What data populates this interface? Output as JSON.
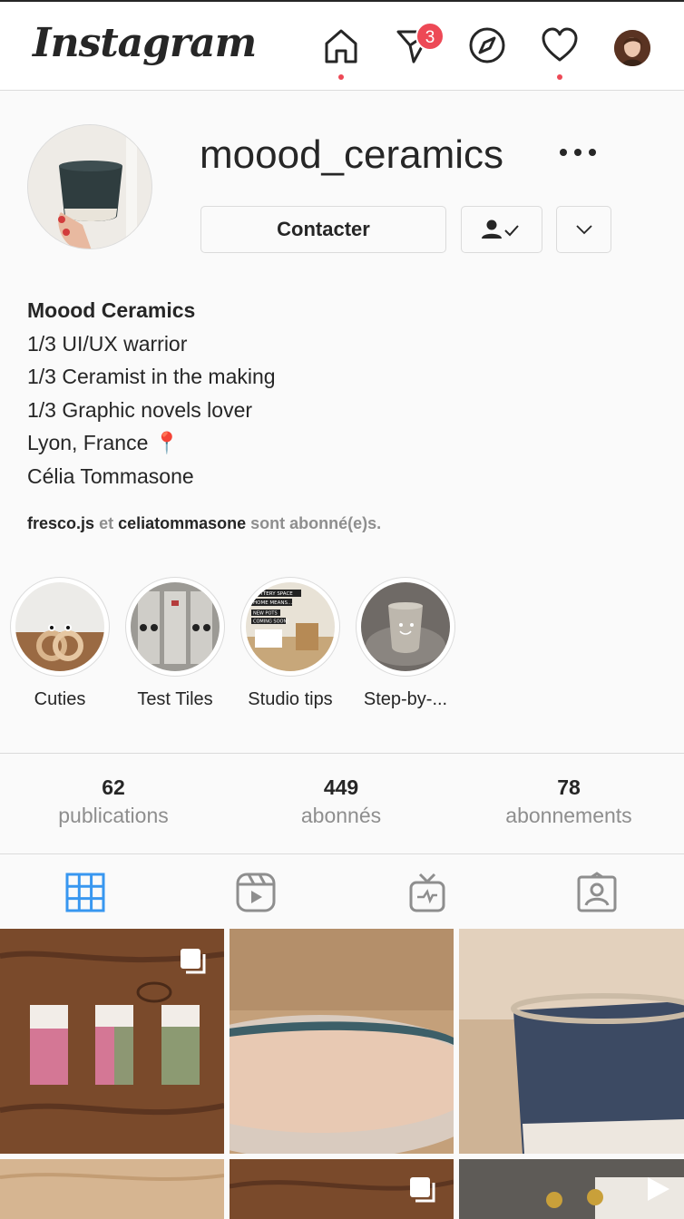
{
  "header": {
    "logo": "Instagram",
    "nav": [
      {
        "icon": "home-icon"
      },
      {
        "icon": "direct-message-icon",
        "badge": "3"
      },
      {
        "icon": "explore-compass-icon"
      },
      {
        "icon": "activity-heart-icon"
      },
      {
        "icon": "profile-avatar"
      }
    ],
    "badge_color": "#ed4956"
  },
  "profile": {
    "username": "moood_ceramics",
    "contact_label": "Contacter",
    "bio": {
      "name": "Moood Ceramics",
      "lines": [
        "1/3 UI/UX warrior",
        "1/3 Ceramist in the making",
        "1/3 Graphic novels lover",
        "Lyon, France 📍",
        "Célia Tommasone"
      ]
    },
    "followed_by": {
      "user1": "fresco.js",
      "connector": "et",
      "user2": "celiatommasone",
      "suffix": "sont abonné(e)s."
    }
  },
  "stories": [
    {
      "label": "Cuties"
    },
    {
      "label": "Test Tiles"
    },
    {
      "label": "Studio tips"
    },
    {
      "label": "Step-by-..."
    }
  ],
  "story_overlay_text": [
    "POTTERY SPACE",
    "HOME MEANS...",
    "NEW POTS",
    "COMING SOON!"
  ],
  "stats": [
    {
      "value": "62",
      "label": "publications"
    },
    {
      "value": "449",
      "label": "abonnés"
    },
    {
      "value": "78",
      "label": "abonnements"
    }
  ],
  "tabs": [
    {
      "icon": "grid-icon",
      "active": true
    },
    {
      "icon": "reels-icon"
    },
    {
      "icon": "igtv-icon"
    },
    {
      "icon": "tagged-icon"
    }
  ],
  "colors": {
    "accent": "#3897f0",
    "text": "#262626",
    "muted": "#8e8e8e",
    "border": "#dbdbdb"
  }
}
